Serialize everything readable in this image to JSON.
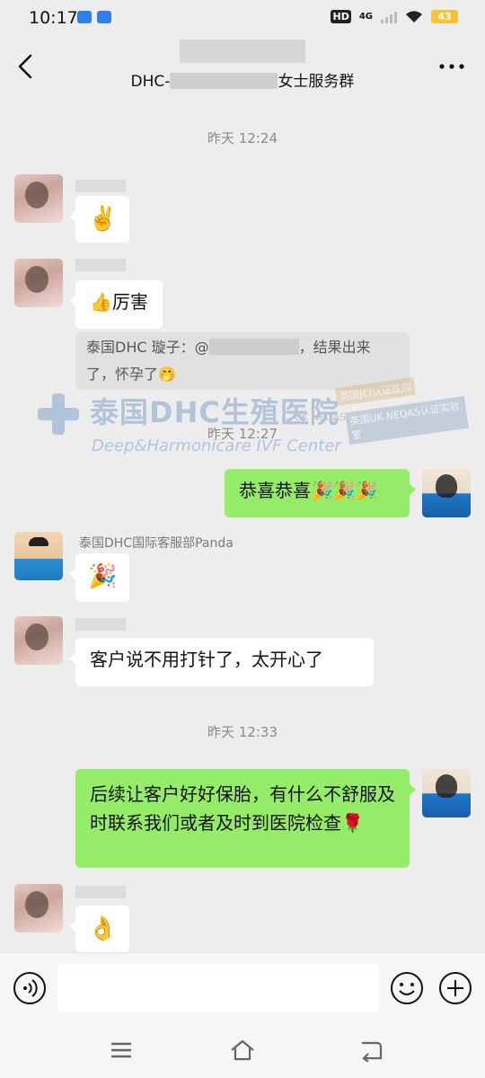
{
  "status_bar": {
    "time": "10:17",
    "hd": "HD",
    "network": "4G",
    "battery": "43"
  },
  "header": {
    "title_prefix": "DHC-",
    "title_suffix": "女士服务群"
  },
  "messages": {
    "ts1": "昨天 12:24",
    "m1_emoji": "✌️",
    "m2_text": "👍厉害",
    "m2_quote_prefix": "泰国DHC 璇子：@",
    "m2_quote_suffix": "，结果出来了，怀孕了🤭",
    "ts2": "昨天 12:27",
    "m3_text": "恭喜恭喜🎉🎉🎉",
    "m4_sender": "泰国DHC国际客服部Panda",
    "m4_emoji": "🎉",
    "m5_text": "客户说不用打针了，太开心了",
    "ts3": "昨天 12:33",
    "m6_text": "后续让客户好好保胎，有什么不舒服及时联系我们或者及时到医院检查🌹",
    "m7_emoji": "👌"
  },
  "watermark": {
    "title": "泰国DHC生殖医院",
    "subtitle": "Deep&Harmonicare IVF Center",
    "badge1": "英国JCI认证医院",
    "badge2": "英国UK NEQAS认证实验室",
    "uk": "UK NEQAS"
  },
  "colors": {
    "background": "#ededed",
    "own_bubble": "#95ec69",
    "other_bubble": "#ffffff"
  }
}
